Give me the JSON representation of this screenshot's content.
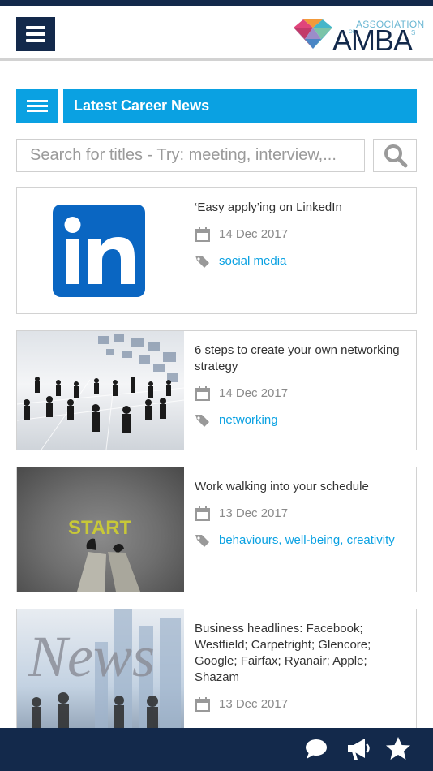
{
  "header": {
    "logo": {
      "association": "ASSOCIATION",
      "of": "OF",
      "name": "AMBA",
      "s": "S"
    }
  },
  "section": {
    "title": "Latest Career News"
  },
  "search": {
    "placeholder": "Search for titles - Try: meeting, interview,..."
  },
  "articles": [
    {
      "title": "‘Easy apply’ing on LinkedIn",
      "date": "14 Dec 2017",
      "tags": "social media",
      "thumbnail": "linkedin-logo"
    },
    {
      "title": "6 steps to create your own networking strategy",
      "date": "14 Dec 2017",
      "tags": "networking",
      "thumbnail": "networking-people"
    },
    {
      "title": "Work walking into your schedule",
      "date": "13 Dec 2017",
      "tags": "behaviours, well-being, creativity",
      "thumbnail": "start-line-feet"
    },
    {
      "title": "Business headlines: Facebook; Westfield; Carpetright; Glencore; Google; Fairfax; Ryanair; Apple; Shazam",
      "date": "13 Dec 2017",
      "tags": "",
      "thumbnail": "news-collage",
      "thumb_text": "News"
    }
  ],
  "bottom_nav": [
    "chat-icon",
    "megaphone-icon",
    "star-icon"
  ],
  "colors": {
    "navy": "#13294b",
    "accent": "#0aa1e2",
    "linkedin": "#0a66c2"
  }
}
